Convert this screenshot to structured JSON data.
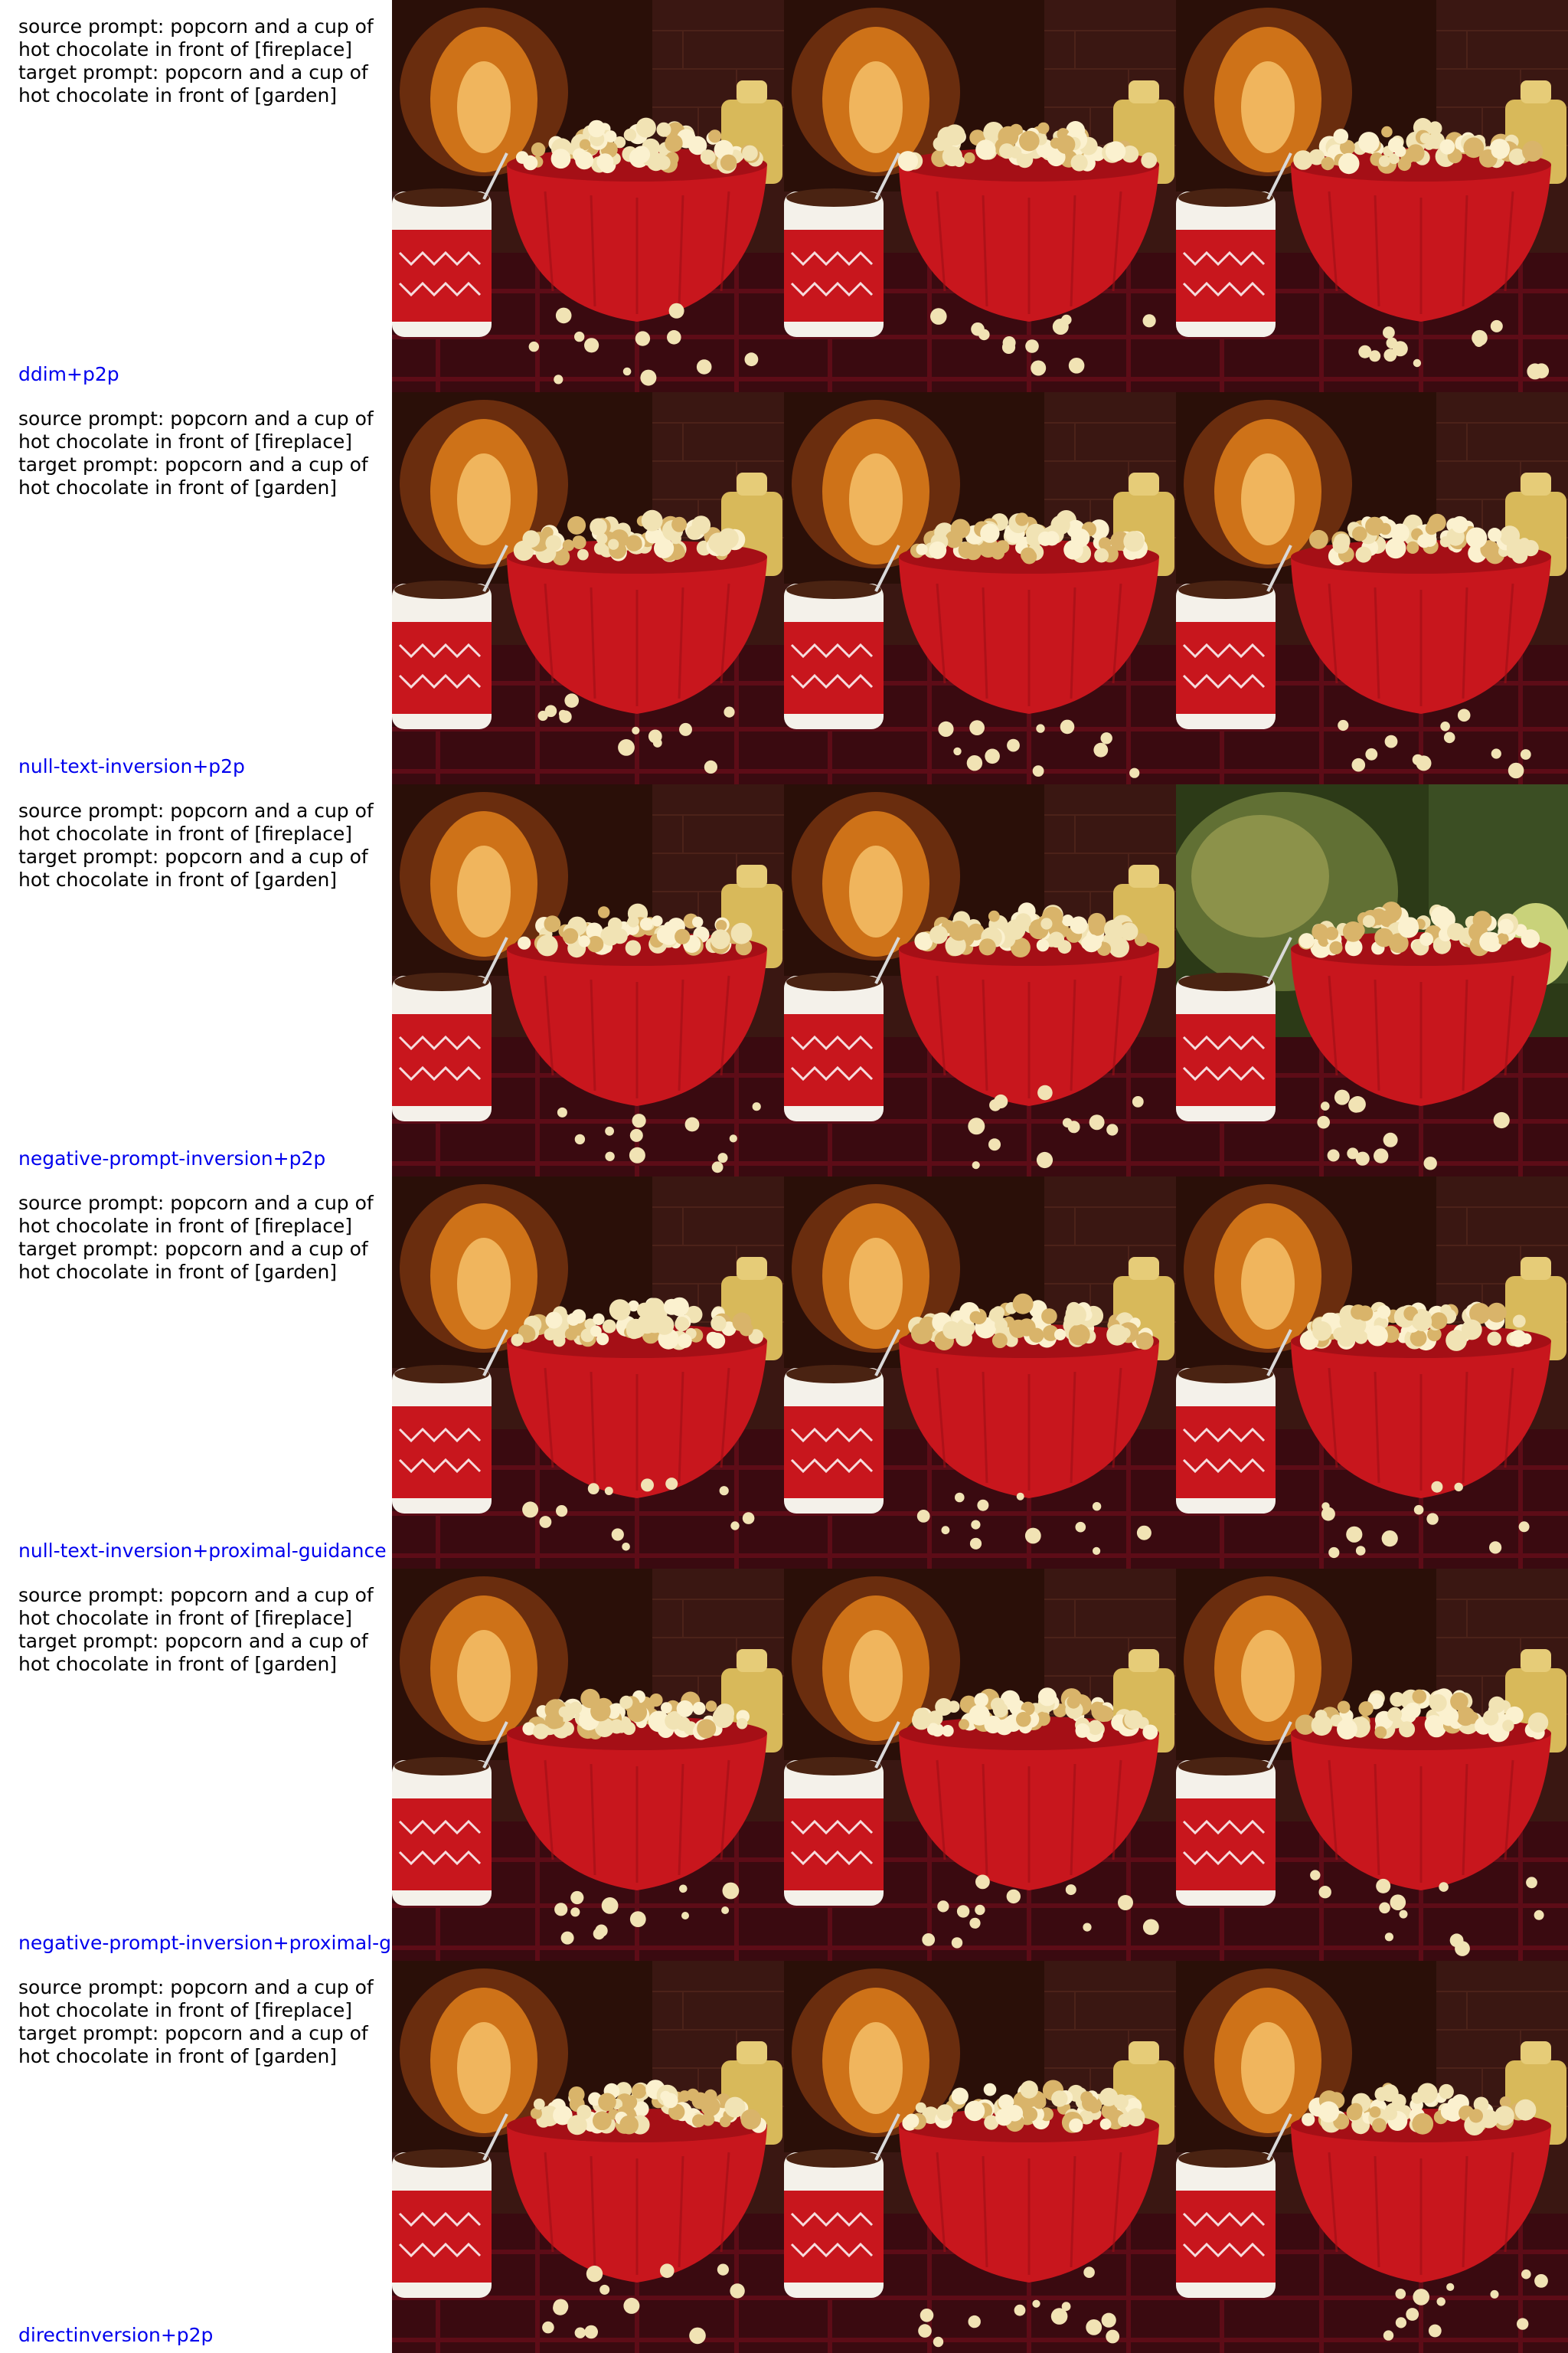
{
  "prompt_text": "source prompt: popcorn and a cup of\nhot chocolate in front of [fireplace]\ntarget prompt: popcorn and a cup of\nhot chocolate in front of [garden]",
  "rows": [
    {
      "method": "ddim+p2p",
      "panels": [
        "source",
        "reconstruction",
        "edited"
      ]
    },
    {
      "method": "null-text-inversion+p2p",
      "panels": [
        "source",
        "reconstruction",
        "edited"
      ]
    },
    {
      "method": "negative-prompt-inversion+p2p",
      "panels": [
        "source",
        "reconstruction",
        "edited"
      ]
    },
    {
      "method": "null-text-inversion+proximal-guidance",
      "panels": [
        "source",
        "reconstruction",
        "edited"
      ]
    },
    {
      "method": "negative-prompt-inversion+proximal-g",
      "panels": [
        "source",
        "reconstruction",
        "edited"
      ]
    },
    {
      "method": "directinversion+p2p",
      "panels": [
        "source",
        "reconstruction",
        "edited"
      ]
    }
  ],
  "colors": {
    "text": "#000000",
    "method_label": "#0000ee",
    "background": "#ffffff",
    "bowl_red": "#c8161d",
    "fire_orange": "#f08a1c",
    "brick_dark": "#3a1712",
    "garden_green": "#6b7a3a",
    "popcorn": "#f1e3b4"
  }
}
